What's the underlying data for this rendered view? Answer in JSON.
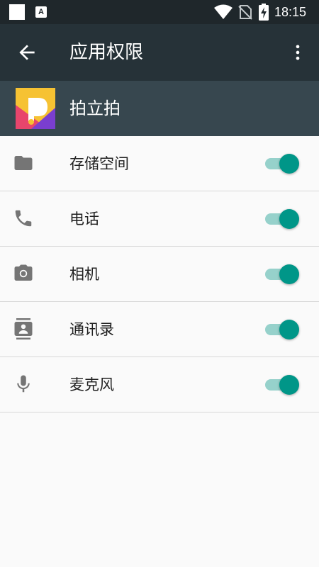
{
  "status_bar": {
    "time": "18:15",
    "notification_letter": "A",
    "icons": [
      "white-square-notification-icon",
      "a-notification-icon",
      "wifi-icon",
      "no-sim-icon",
      "battery-charging-icon"
    ]
  },
  "app_bar": {
    "title": "应用权限",
    "back_icon": "arrow-back-icon",
    "more_icon": "more-vert-icon"
  },
  "app_header": {
    "name": "拍立拍",
    "icon": "app-logo-icon"
  },
  "permissions": [
    {
      "label": "存储空间",
      "icon": "folder-icon",
      "enabled": true
    },
    {
      "label": "电话",
      "icon": "phone-icon",
      "enabled": true
    },
    {
      "label": "相机",
      "icon": "camera-icon",
      "enabled": true
    },
    {
      "label": "通讯录",
      "icon": "contacts-icon",
      "enabled": true
    },
    {
      "label": "麦克风",
      "icon": "microphone-icon",
      "enabled": true
    }
  ],
  "colors": {
    "status_bar": "#1f272b",
    "app_bar": "#263238",
    "app_header": "#37474f",
    "toggle_thumb": "#009688",
    "toggle_track": "#96d1cb",
    "icon_gray": "#757575"
  }
}
